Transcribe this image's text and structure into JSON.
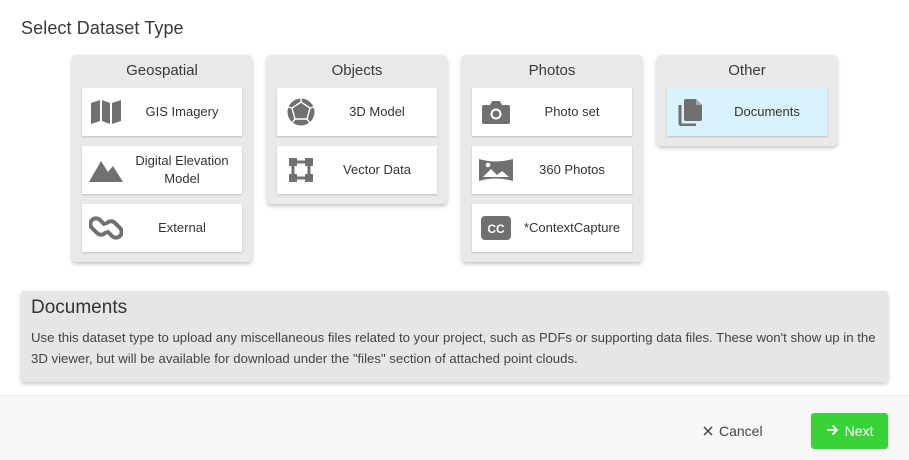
{
  "title": "Select Dataset Type",
  "groups": [
    {
      "title": "Geospatial",
      "items": [
        {
          "label": "GIS Imagery",
          "icon": "map-icon"
        },
        {
          "label": "Digital Elevation Model",
          "icon": "mountain-icon"
        },
        {
          "label": "External",
          "icon": "link-icon"
        }
      ]
    },
    {
      "title": "Objects",
      "items": [
        {
          "label": "3D Model",
          "icon": "polyhedron-icon"
        },
        {
          "label": "Vector Data",
          "icon": "vector-shape-icon"
        }
      ]
    },
    {
      "title": "Photos",
      "items": [
        {
          "label": "Photo set",
          "icon": "camera-icon"
        },
        {
          "label": "360 Photos",
          "icon": "panorama-icon"
        },
        {
          "label": "*ContextCapture",
          "icon": "cc-icon",
          "icon_text": "CC"
        }
      ]
    },
    {
      "title": "Other",
      "items": [
        {
          "label": "Documents",
          "icon": "documents-icon",
          "selected": true
        }
      ]
    }
  ],
  "description": {
    "title": "Documents",
    "text": "Use this dataset type to upload any miscellaneous files related to your project, such as PDFs or supporting data files. These won't show up in the 3D viewer, but will be available for download under the \"files\" section of attached point clouds."
  },
  "footer": {
    "cancel_label": "Cancel",
    "next_label": "Next"
  },
  "colors": {
    "accent_green": "#39d339",
    "selected_bg": "#d8f3fb",
    "icon_gray": "#707070"
  }
}
